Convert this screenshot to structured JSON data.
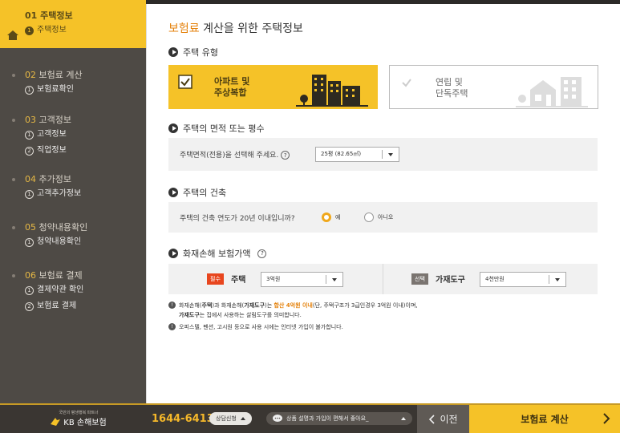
{
  "sidebar": {
    "groups": [
      {
        "num": "01",
        "title": "주택정보",
        "items": [
          {
            "n": "1",
            "label": "주택정보"
          }
        ]
      },
      {
        "num": "02",
        "title": "보험료 계산",
        "items": [
          {
            "n": "1",
            "label": "보험료확인"
          }
        ]
      },
      {
        "num": "03",
        "title": "고객정보",
        "items": [
          {
            "n": "1",
            "label": "고객정보"
          },
          {
            "n": "2",
            "label": "직업정보"
          }
        ]
      },
      {
        "num": "04",
        "title": "추가정보",
        "items": [
          {
            "n": "1",
            "label": "고객추가정보"
          }
        ]
      },
      {
        "num": "05",
        "title": "청약내용확인",
        "items": [
          {
            "n": "1",
            "label": "청약내용확인"
          }
        ]
      },
      {
        "num": "06",
        "title": "보험료 결제",
        "items": [
          {
            "n": "1",
            "label": "결제약관 확인"
          },
          {
            "n": "2",
            "label": "보험료 결제"
          }
        ]
      }
    ]
  },
  "main": {
    "title_accent": "보험료",
    "title_rest": " 계산을 위한 주택정보",
    "sec_type": "주택 유형",
    "card_apt": {
      "line1": "아파트 및",
      "line2": "주상복합"
    },
    "card_house": {
      "line1": "연립 및",
      "line2": "단독주택"
    },
    "sec_area": "주택의 면적 또는 평수",
    "area_label": "주택면적(전용)을 선택해 주세요.",
    "area_value": "25평 (82.65㎡)",
    "sec_build": "주택의 건축",
    "build_question": "주택의 건축 연도가 20년 이내입니까?",
    "yes": "예",
    "no": "아니오",
    "sec_amount": "화재손해 보험가액",
    "req_badge": "필수",
    "house_label": "주택",
    "house_value": "3억원",
    "opt_badge": "선택",
    "goods_label": "가재도구",
    "goods_value": "4천만원",
    "note1_a": "화재손해(",
    "note1_b": "주택",
    "note1_c": ")과 화재손해(",
    "note1_d": "가재도구",
    "note1_e": ")는 ",
    "note1_hl": "합산 4억원 이내",
    "note1_f": "(단, 주택구조가 3급인경우 3억원 이내)이며,",
    "note1_g": "가재도구",
    "note1_h": "는 집에서 사용하는 살림도구를 의미합니다.",
    "note2": "오피스텔, 펜션, 고시원 등으로 사용 시에는 인터넷 가입이 불가합니다."
  },
  "footer": {
    "logo_tag": "국민의 평생행복 파트너",
    "logo_name": "KB 손해보험",
    "phone": "1644-6413",
    "consult": "상담신청",
    "chat": "상품 설명과 가입이 편해서 좋아요_",
    "prev": "이전",
    "calc": "보험료 계산"
  }
}
